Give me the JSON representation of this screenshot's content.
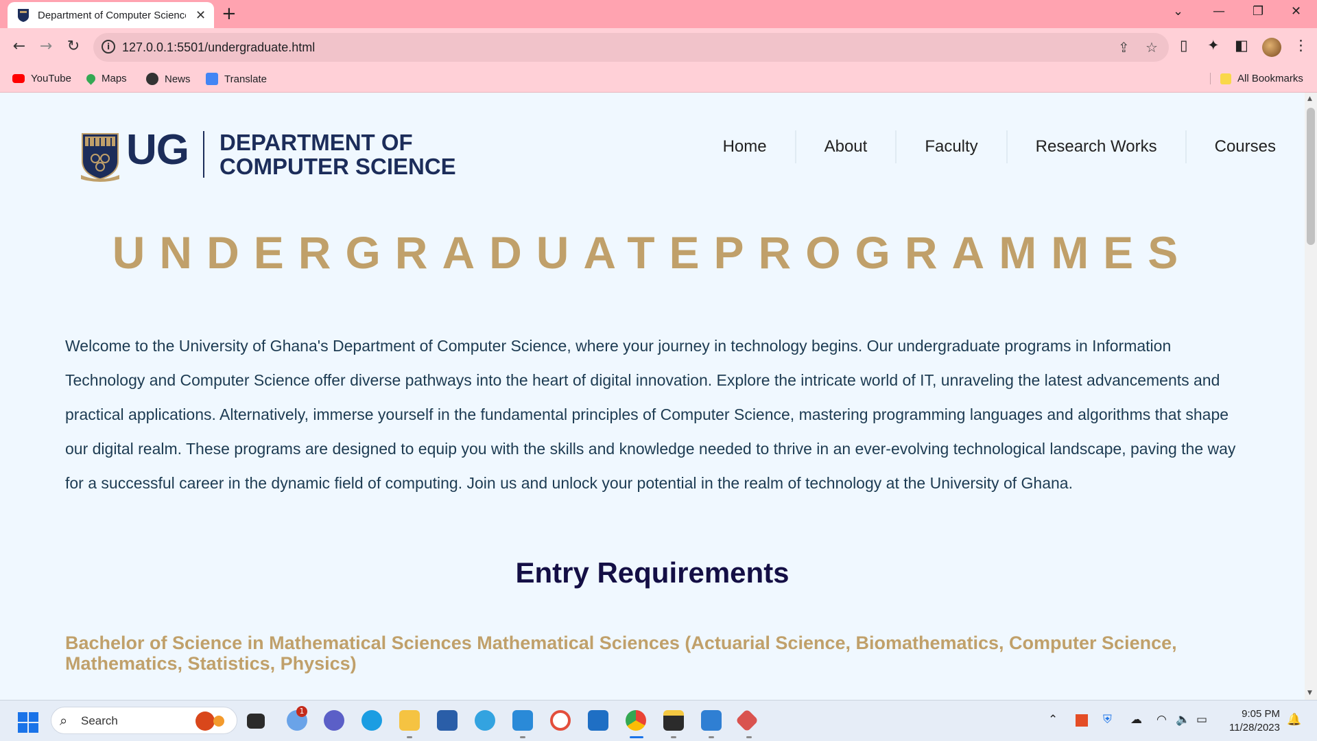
{
  "browser": {
    "tab_title": "Department of Computer Science",
    "new_tab": "+",
    "tab_close": "✕",
    "url": "127.0.0.1:5501/undergraduate.html",
    "bookmarks": [
      {
        "label": "YouTube",
        "icon": "youtube-icon",
        "color": "#ff0000"
      },
      {
        "label": "Maps",
        "icon": "maps-icon",
        "color": "#34a853"
      },
      {
        "label": "News",
        "icon": "news-icon",
        "color": "#333333"
      },
      {
        "label": "Translate",
        "icon": "translate-icon",
        "color": "#4285f4"
      }
    ],
    "all_bookmarks": "All Bookmarks"
  },
  "site": {
    "logo_ug": "UG",
    "logo_line1": "DEPARTMENT OF",
    "logo_line2": "COMPUTER SCIENCE",
    "nav": [
      "Home",
      "About",
      "Faculty",
      "Research Works",
      "Courses"
    ],
    "page_title": "UNDERGRADUATEPROGRAMMES",
    "intro": "Welcome to the University of Ghana's Department of Computer Science, where your journey in technology begins. Our undergraduate programs in Information Technology and Computer Science offer diverse pathways into the heart of digital innovation. Explore the intricate world of IT, unraveling the latest advancements and practical applications. Alternatively, immerse yourself in the fundamental principles of Computer Science, mastering programming languages and algorithms that shape our digital realm. These programs are designed to equip you with the skills and knowledge needed to thrive in an ever-evolving technological landscape, paving the way for a successful career in the dynamic field of computing. Join us and unlock your potential in the realm of technology at the University of Ghana.",
    "section_title": "Entry Requirements",
    "program_title": "Bachelor of Science in Mathematical Sciences Mathematical Sciences (Actuarial Science, Biomathematics, Computer Science, Mathematics, Statistics, Physics)",
    "colors": {
      "navy": "#1c2d5a",
      "gold": "#c0a06a",
      "bg": "#f0f8ff"
    }
  },
  "taskbar": {
    "search_label": "Search",
    "notification_count": "1",
    "time": "9:05 PM",
    "date": "11/28/2023"
  }
}
